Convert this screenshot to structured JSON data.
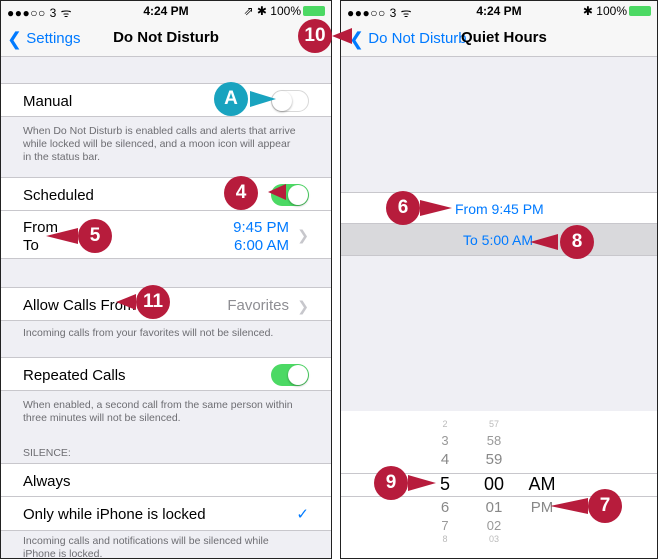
{
  "status_bar": {
    "carrier": "●●●○○ 3 ᯤ",
    "time": "4:24 PM",
    "left_right": "⇗ ✱ 100%",
    "right_right": "✱ 100%"
  },
  "left": {
    "nav": {
      "back": "Settings",
      "title": "Do Not Disturb"
    },
    "manual_label": "Manual",
    "manual_on": false,
    "manual_footer": "When Do Not Disturb is enabled calls and alerts that arrive while locked will be silenced, and a moon icon will appear in the status bar.",
    "scheduled_label": "Scheduled",
    "scheduled_on": true,
    "from_label": "From",
    "to_label": "To",
    "from_time": "9:45 PM",
    "to_time": "6:00 AM",
    "allow_calls_label": "Allow Calls From",
    "allow_calls_value": "Favorites",
    "allow_calls_footer": "Incoming calls from your favorites will not be silenced.",
    "repeated_label": "Repeated Calls",
    "repeated_on": true,
    "repeated_footer": "When enabled, a second call from the same person within three minutes will not be silenced.",
    "silence_header": "SILENCE:",
    "always_label": "Always",
    "locked_label": "Only while iPhone is locked",
    "locked_footer": "Incoming calls and notifications will be silenced while iPhone is locked."
  },
  "right": {
    "nav": {
      "back": "Do Not Disturb",
      "title": "Quiet Hours"
    },
    "from_row": "From 9:45 PM",
    "to_row": "To 5:00 AM",
    "picker": {
      "hours": [
        "2",
        "3",
        "4",
        "5",
        "6",
        "7",
        "8"
      ],
      "minutes": [
        "57",
        "58",
        "59",
        "00",
        "01",
        "02",
        "03"
      ],
      "ampm": [
        "AM",
        "PM"
      ]
    }
  },
  "callouts": {
    "a": "A",
    "four": "4",
    "five": "5",
    "eleven": "11",
    "ten": "10",
    "six": "6",
    "eight": "8",
    "nine": "9",
    "seven": "7"
  },
  "colors": {
    "accent": "#007aff",
    "toggle_on": "#4cd964",
    "callout_red": "#b71c3c",
    "callout_teal": "#19a3bf"
  },
  "icons": {
    "back": "chevron-left-icon",
    "disclosure": "chevron-right-icon",
    "check": "checkmark-icon"
  }
}
